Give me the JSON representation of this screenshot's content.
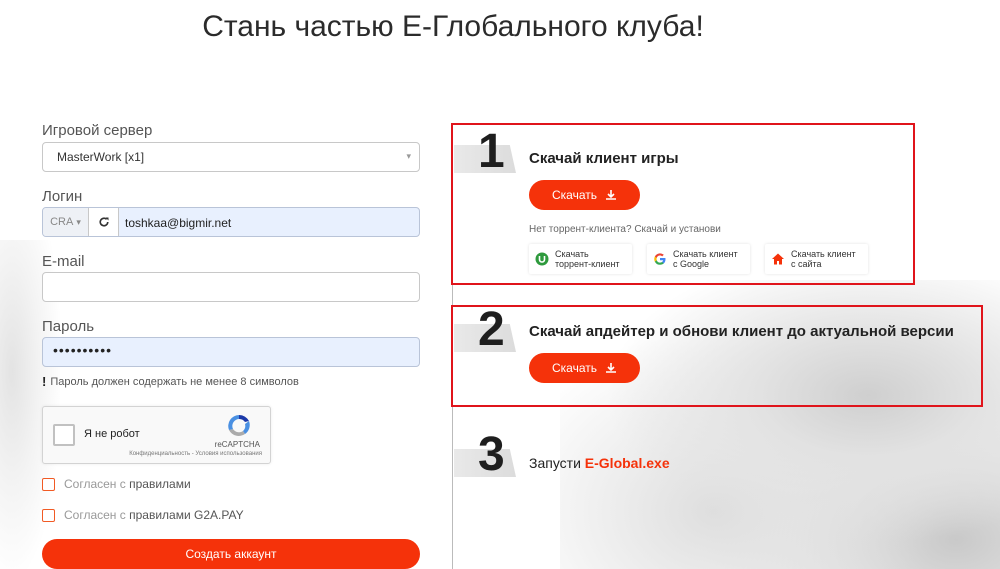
{
  "page": {
    "title": "Стань частью Е-Глобального клуба!"
  },
  "form": {
    "server_label": "Игровой сервер",
    "server_value": "MasterWork [x1]",
    "login_label": "Логин",
    "login_prefix": "CRA",
    "login_value": "toshkaa@bigmir.net",
    "email_label": "E-mail",
    "email_value": "",
    "password_label": "Пароль",
    "password_value": "••••••••••",
    "password_hint": "Пароль должен содержать не менее 8 символов",
    "captcha": {
      "label": "Я не робот",
      "brand": "reCAPTCHA",
      "legal": "Конфиденциальность - Условия использования"
    },
    "agree_rules_prefix": "Согласен с ",
    "agree_rules_link": "правилами",
    "agree_g2a_prefix": "Согласен с ",
    "agree_g2a_link": "правилами G2A.PAY",
    "submit_label": "Создать аккаунт"
  },
  "steps": {
    "step1": {
      "number": "1",
      "title": "Скачай клиент игры",
      "button": "Скачать",
      "note": "Нет торрент-клиента? Скачай и установи",
      "alt": [
        {
          "line1": "Скачать",
          "line2": "торрент-клиент",
          "icon": "utorrent-icon"
        },
        {
          "line1": "Скачать клиент",
          "line2": "с Google",
          "icon": "google-icon"
        },
        {
          "line1": "Скачать клиент",
          "line2": "с сайта",
          "icon": "home-icon"
        }
      ]
    },
    "step2": {
      "number": "2",
      "title": "Скачай апдейтер и обнови клиент до актуальной версии",
      "button": "Скачать"
    },
    "step3": {
      "number": "3",
      "prefix": "Запусти ",
      "file": "E-Global.exe"
    }
  },
  "colors": {
    "accent": "#f5320a",
    "highlight_border": "#e0141b",
    "google_blue": "#4285f4",
    "utorrent_green": "#2e9a3d"
  }
}
